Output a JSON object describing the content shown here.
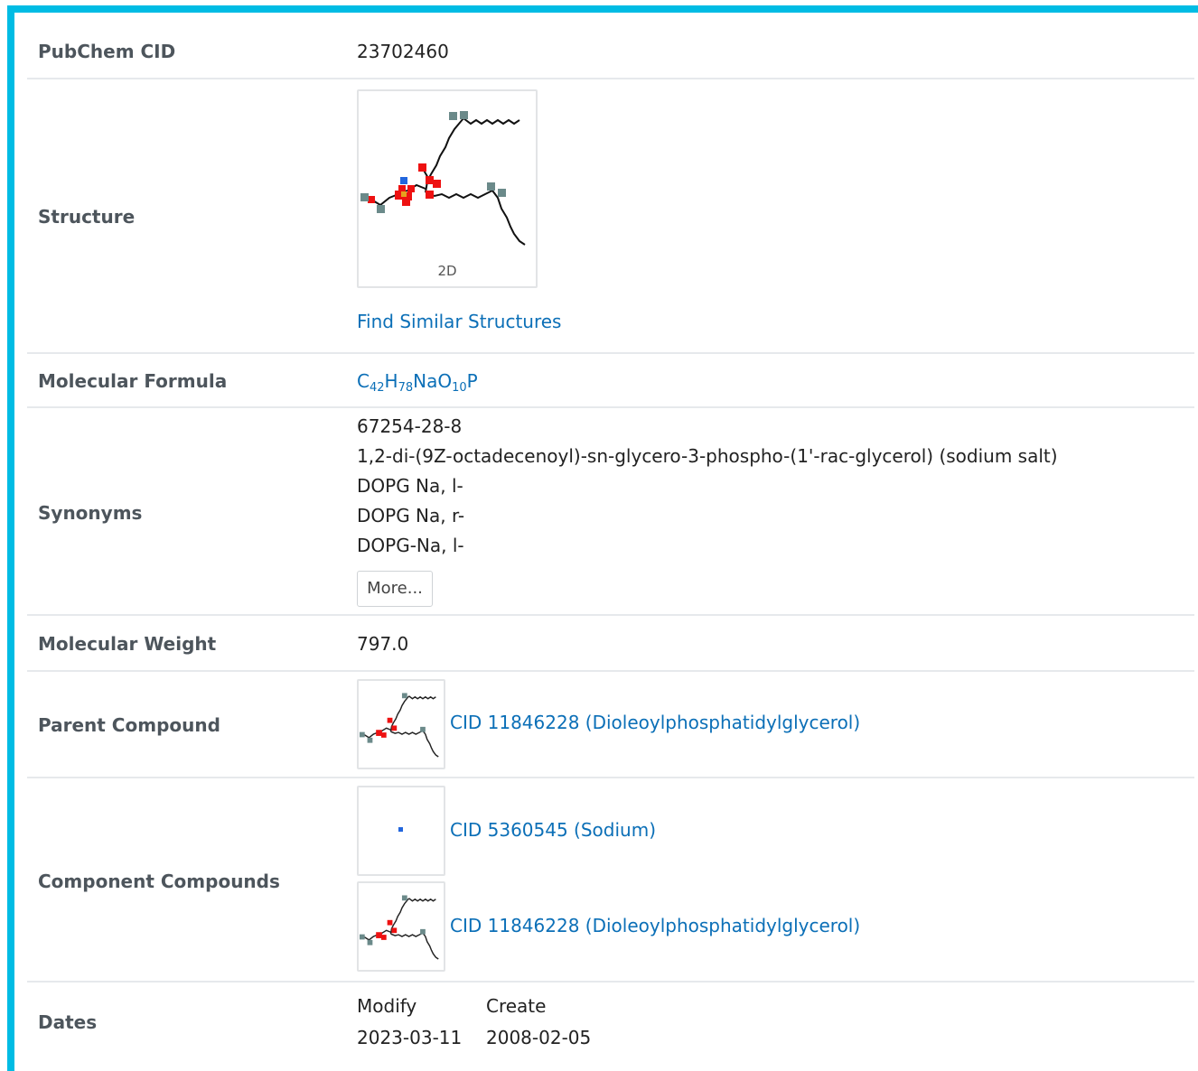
{
  "rows": {
    "cid": {
      "label": "PubChem CID",
      "value": "23702460"
    },
    "structure": {
      "label": "Structure",
      "badge": "2D",
      "link": "Find Similar Structures"
    },
    "formula": {
      "label": "Molecular Formula",
      "parts": [
        "C",
        "42",
        "H",
        "78",
        "NaO",
        "10",
        "P"
      ]
    },
    "synonyms": {
      "label": "Synonyms",
      "items": [
        "67254-28-8",
        "1,2-di-(9Z-octadecenoyl)-sn-glycero-3-phospho-(1'-rac-glycerol) (sodium salt)",
        "DOPG Na, l-",
        "DOPG Na, r-",
        "DOPG-Na, l-"
      ],
      "more_label": "More..."
    },
    "weight": {
      "label": "Molecular Weight",
      "value": "797.0"
    },
    "parent": {
      "label": "Parent Compound",
      "link": "CID 11846228 (Dioleoylphosphatidylglycerol)"
    },
    "components": {
      "label": "Component Compounds",
      "items": [
        {
          "link": "CID 5360545 (Sodium)"
        },
        {
          "link": "CID 11846228 (Dioleoylphosphatidylglycerol)"
        }
      ]
    },
    "dates": {
      "label": "Dates",
      "modify_label": "Modify",
      "create_label": "Create",
      "modify_value": "2023-03-11",
      "create_value": "2008-02-05"
    }
  },
  "colors": {
    "accent": "#00bce4",
    "link": "#0b6fb7",
    "label": "#4d555c",
    "divider": "#e6e9ec"
  }
}
